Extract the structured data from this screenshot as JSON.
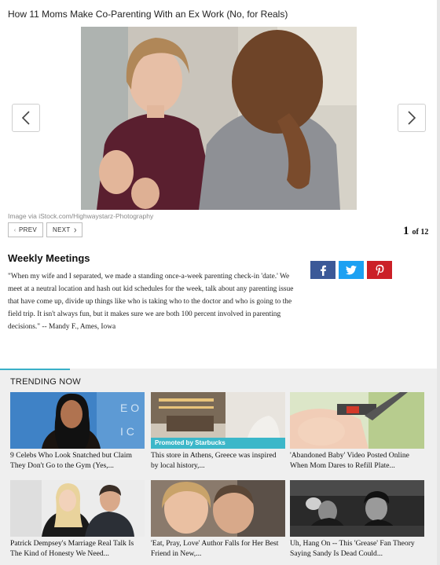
{
  "slideshow": {
    "title": "How 11 Moms Make Co-Parenting With an Ex Work (No, for Reals)",
    "image_credit": "Image via iStock.com/Highwaystarz-Photography",
    "prev_label": "PREV",
    "next_label": "NEXT",
    "current": "1",
    "of_total": "of 12"
  },
  "article": {
    "heading": "Weekly Meetings",
    "body": "\"When my wife and I separated, we made a standing once-a-week parenting check-in 'date.' We meet at a neutral location and hash out kid schedules for the week, talk about any parenting issue that have come up, divide up things like who is taking who to the doctor and who is going to the field trip. It isn't always fun, but it makes sure we are both 100 percent involved in parenting decisions.\" -- Mandy F., Ames, Iowa"
  },
  "share": {
    "facebook_color": "#3b5998",
    "twitter_color": "#1da1f2",
    "pinterest_color": "#cb2027"
  },
  "trending": {
    "title": "TRENDING NOW",
    "accent_color": "#3ab0c8",
    "items": [
      {
        "caption": "9 Celebs Who Look Snatched but Claim They Don't Go to the Gym (Yes,..."
      },
      {
        "caption": "This store in Athens, Greece was inspired by local history,...",
        "promo": "Promoted by Starbucks"
      },
      {
        "caption": "'Abandoned Baby' Video Posted Online When Mom Dares to Refill Plate..."
      },
      {
        "caption": "Patrick Dempsey's Marriage Real Talk Is The Kind of Honesty We Need..."
      },
      {
        "caption": "'Eat, Pray, Love' Author Falls for Her Best Friend in New,..."
      },
      {
        "caption": "Uh, Hang On -- This 'Grease' Fan Theory Saying Sandy Is Dead Could..."
      }
    ]
  }
}
